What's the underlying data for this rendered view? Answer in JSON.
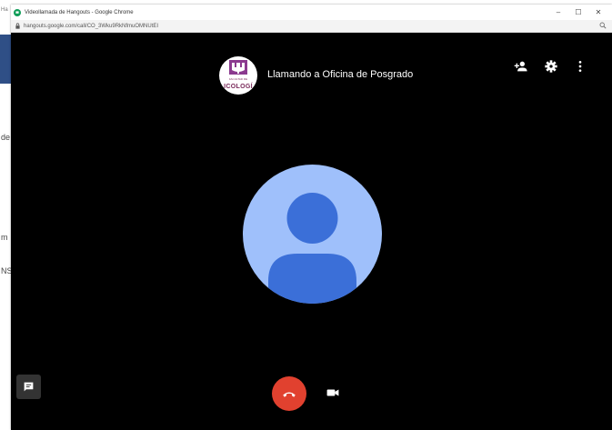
{
  "background_page": {
    "fragments": [
      "Ha",
      "de",
      "m",
      "NS"
    ]
  },
  "window": {
    "title": "Videollamada de Hangouts - Google Chrome",
    "url": "hangouts.google.com/call/CO_3Wku9RkNfmuOMNUtEI",
    "controls": {
      "minimize": "–",
      "maximize": "☐",
      "close": "✕"
    }
  },
  "call": {
    "status_text": "Llamando a Oficina de Posgrado",
    "logo_text": "ICOLOGÍ",
    "logo_subtext": "FACULTAD DE",
    "icons": {
      "add_person": "add-person-icon",
      "settings": "gear-icon",
      "more": "more-vert-icon",
      "chat": "chat-icon",
      "hangup": "hangup-icon",
      "video": "video-camera-icon"
    },
    "colors": {
      "background": "#000000",
      "avatar_bg": "#9fc0fb",
      "avatar_fg": "#3b6fd8",
      "hangup": "#e1412f"
    }
  }
}
